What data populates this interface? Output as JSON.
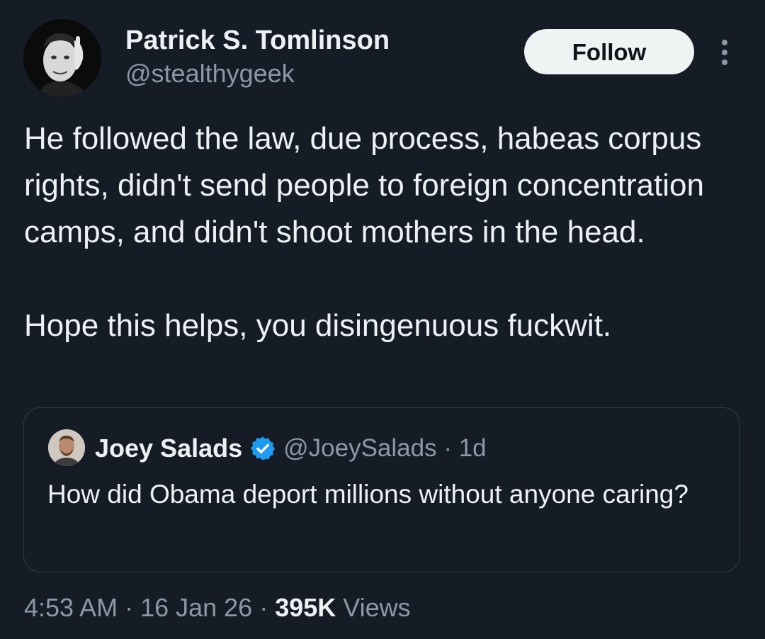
{
  "tweet": {
    "author": {
      "display_name": "Patrick S. Tomlinson",
      "handle": "@stealthygeek",
      "avatar_icon": "user-avatar-photo"
    },
    "follow_label": "Follow",
    "more_icon": "more-vertical-icon",
    "paragraphs": [
      "He followed the law, due process, habeas corpus rights, didn't send people to foreign concentration camps, and didn't shoot mothers in the head.",
      "Hope this helps, you disingenuous fuckwit."
    ],
    "quote": {
      "display_name": "Joey Salads",
      "verified_icon": "verified-badge-icon",
      "verified_color": "#1d9bf0",
      "handle_time": "@JoeySalads · 1d",
      "text": "How did Obama deport millions without anyone caring?"
    },
    "meta": {
      "timestamp": "4:53 AM · 16 Jan 26 · ",
      "views_count": "395K",
      "views_label": " Views"
    }
  },
  "colors": {
    "background": "#151c26",
    "primary_text": "#eef1f4",
    "secondary_text": "#8b98a5",
    "follow_button_bg": "#eff3f4",
    "border": "#2f3b47"
  }
}
